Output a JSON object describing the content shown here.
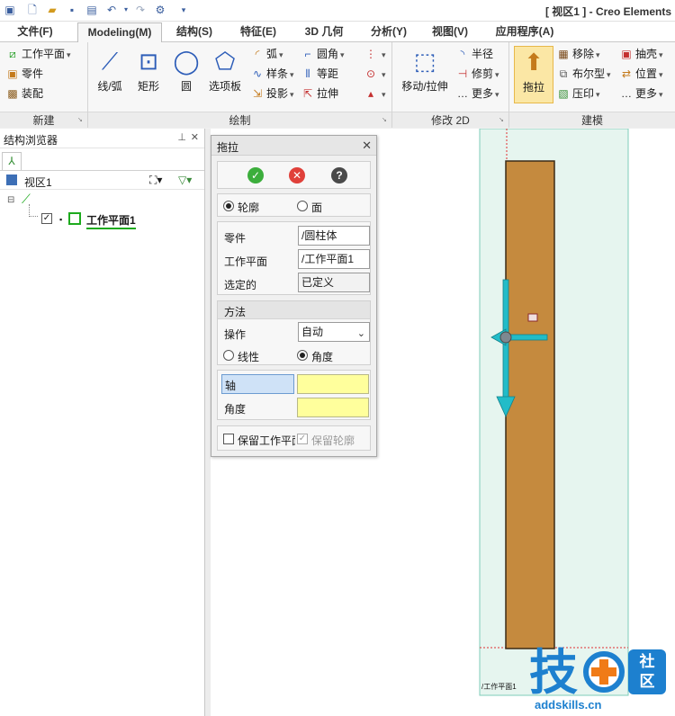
{
  "window": {
    "title": "[ 视区1 ] - Creo Elements"
  },
  "quick_access": [
    "new-icon",
    "open-icon",
    "save-icon",
    "print-preview-icon",
    "undo-icon",
    "redo-icon",
    "options-icon"
  ],
  "tabs": [
    {
      "label": "文件(F)"
    },
    {
      "label": "Modeling(M)"
    },
    {
      "label": "结构(S)"
    },
    {
      "label": "特征(E)"
    },
    {
      "label": "3D 几何"
    },
    {
      "label": "分析(Y)"
    },
    {
      "label": "视图(V)"
    },
    {
      "label": "应用程序(A)"
    }
  ],
  "ribbon": {
    "new_group": {
      "label": "新建",
      "items": [
        "工作平面",
        "零件",
        "装配"
      ]
    },
    "draw_group": {
      "label": "绘制",
      "large": [
        "线/弧",
        "矩形",
        "圆",
        "选项板"
      ],
      "small": [
        "弧",
        "样条",
        "投影",
        "圆角",
        "等距",
        "拉伸"
      ]
    },
    "modify_group": {
      "label": "修改 2D",
      "large": "移动/拉伸",
      "small": [
        "半径",
        "修剪",
        "更多"
      ]
    },
    "model_group": {
      "label": "建模",
      "large": "拖拉",
      "small": [
        "移除",
        "布尔型",
        "压印",
        "抽壳",
        "位置",
        "更多"
      ]
    }
  },
  "browser": {
    "title": "结构浏览器",
    "view": "视区1",
    "tree_item": "工作平面1"
  },
  "dialog": {
    "title": "拖拉",
    "mode_options": [
      "轮廓",
      "面"
    ],
    "fields": [
      {
        "label": "零件",
        "value": "/圆柱体"
      },
      {
        "label": "工作平面",
        "value": "/工作平面1"
      },
      {
        "label": "选定的",
        "value": "已定义"
      }
    ],
    "method": {
      "header": "方法",
      "op_label": "操作",
      "op_value": "自动",
      "options": [
        "线性",
        "角度"
      ]
    },
    "axis_label": "轴",
    "angle_label": "角度",
    "keep_workplane": "保留工作平面",
    "keep_profile": "保留轮廓"
  },
  "viewport": {
    "workplane_label": "/工作平面1",
    "colors": {
      "workplane_fill": "#e6f5ef",
      "workplane_border": "#7fcdb8",
      "body_fill": "#c58a3e",
      "body_edge": "#3b2b16",
      "arrow": "#22bcc8",
      "limit_line": "#e03030"
    }
  },
  "watermark": {
    "glyph": "技",
    "side_top": "社",
    "side_bottom": "区",
    "url": "addskills.cn"
  }
}
